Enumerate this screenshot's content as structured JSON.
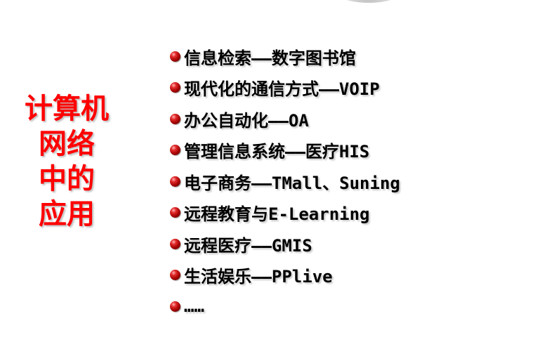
{
  "side_title": [
    "计算机",
    "网络",
    "中的",
    "应用"
  ],
  "colors": {
    "title": "#ff0000",
    "bullet": "#b00000",
    "text": "#000000"
  },
  "items": [
    "信息检索——数字图书馆",
    "现代化的通信方式——VOIP",
    "办公自动化——OA",
    "管理信息系统——医疗HIS",
    "电子商务——TMall、Suning",
    "远程教育与E-Learning",
    "远程医疗——GMIS",
    "生活娱乐——PPlive",
    "……"
  ]
}
